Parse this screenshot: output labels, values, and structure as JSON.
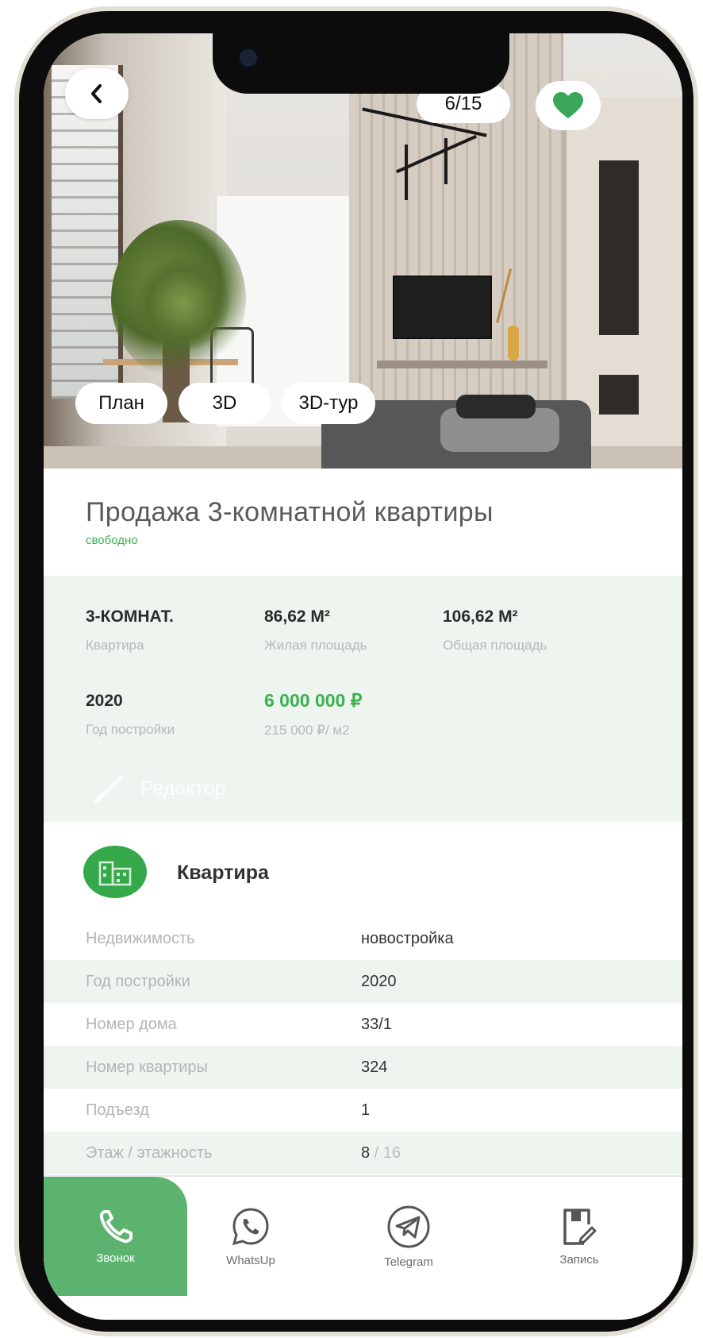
{
  "gallery": {
    "counter": "6/15",
    "media_tabs": [
      {
        "label": "План"
      },
      {
        "label": "3D"
      },
      {
        "label": "3D-тур"
      }
    ]
  },
  "listing": {
    "title": "Продажа 3-комнатной квартиры",
    "status": "свободно"
  },
  "specs": [
    {
      "value": "3-КОМНАТ.",
      "label": "Квартира"
    },
    {
      "value": "86,62 М²",
      "label": "Жилая площадь"
    },
    {
      "value": "106,62 М²",
      "label": "Общая площадь"
    },
    {
      "value": "2020",
      "label": "Год постройки"
    },
    {
      "value": "6 000 000 ₽",
      "label": "215 000 ₽/ м2"
    }
  ],
  "editor_label": "Редактор",
  "details": {
    "title": "Квартира",
    "rows": [
      {
        "key": "Недвижимость",
        "value": "новостройка"
      },
      {
        "key": "Год постройки",
        "value": "2020"
      },
      {
        "key": "Номер дома",
        "value": "33/1"
      },
      {
        "key": "Номер квартиры",
        "value": "324"
      },
      {
        "key": "Подъезд",
        "value": "1"
      },
      {
        "key": "Этаж / этажность",
        "value": "8",
        "value_suffix": " / 16"
      }
    ]
  },
  "actions": [
    {
      "label": "Звонок"
    },
    {
      "label": "WhatsUp"
    },
    {
      "label": "Telegram"
    },
    {
      "label": "Запись"
    }
  ],
  "colors": {
    "accent_green": "#3bb14f",
    "call_button": "#5cb36f",
    "panel_tint": "#eef5ef",
    "favorite_heart": "#3aa657"
  },
  "icons": [
    "back-chevron-icon",
    "heart-icon",
    "apartment-building-icon",
    "pencil-icon",
    "phone-icon",
    "whatsapp-icon",
    "telegram-icon",
    "booking-icon"
  ]
}
